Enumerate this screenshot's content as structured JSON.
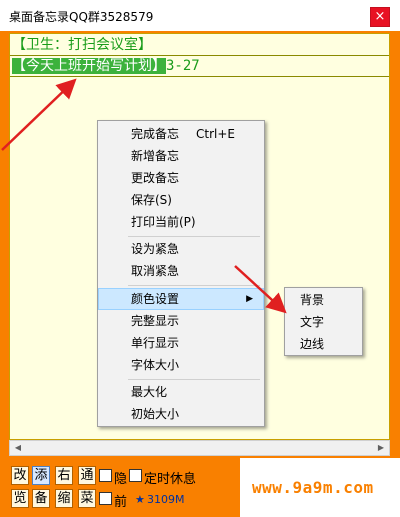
{
  "window": {
    "title": "桌面备忘录QQ群3528579",
    "close_glyph": "×"
  },
  "notes": {
    "line1": "【卫生：打扫会议室】",
    "line2_highlight": "【今天上班开始写计划】",
    "line2_suffix": "3-27"
  },
  "menu": {
    "items": [
      {
        "label": "完成备忘",
        "shortcut": "Ctrl+E"
      },
      {
        "label": "新增备忘"
      },
      {
        "label": "更改备忘"
      },
      {
        "label": "保存(S)"
      },
      {
        "label": "打印当前(P)"
      },
      {
        "label": "设为紧急"
      },
      {
        "label": "取消紧急"
      },
      {
        "label": "颜色设置",
        "submenu_arrow": "▶"
      },
      {
        "label": "完整显示"
      },
      {
        "label": "单行显示"
      },
      {
        "label": "字体大小"
      },
      {
        "label": "最大化"
      },
      {
        "label": "初始大小"
      }
    ],
    "submenu": [
      "背景",
      "文字",
      "边线"
    ]
  },
  "toolbar": {
    "buttons_row1": [
      "改",
      "添",
      "右",
      "通"
    ],
    "checkbox1_label": "隐",
    "checkbox2_label": "定时休息",
    "buttons_row2": [
      "览",
      "备",
      "缩",
      "菜"
    ],
    "checkbox3_label": "前",
    "star": "★",
    "count": "3109M"
  },
  "watermark": "www.9a9m.com",
  "colors": {
    "frame": "#f98000",
    "note_bg": "#ffffe0",
    "note_text": "#1a9c1a",
    "highlight": "#3cb23c",
    "close": "#e81123",
    "annotation_arrow": "#e02020"
  }
}
